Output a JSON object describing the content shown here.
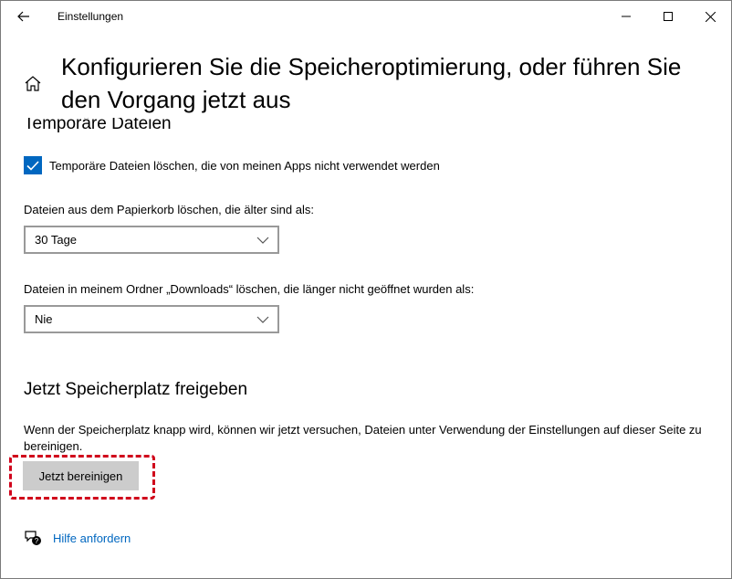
{
  "window": {
    "title": "Einstellungen"
  },
  "header": {
    "heading": "Konfigurieren Sie die Speicheroptimierung, oder führen Sie den Vorgang jetzt aus"
  },
  "temp_files": {
    "section_title": "Temporäre Dateien",
    "checkbox_label": "Temporäre Dateien löschen, die von meinen Apps nicht verwendet werden",
    "checkbox_checked": true,
    "recycle_label": "Dateien aus dem Papierkorb löschen, die älter sind als:",
    "recycle_value": "30 Tage",
    "downloads_label": "Dateien in meinem Ordner „Downloads“ löschen, die länger nicht geöffnet wurden als:",
    "downloads_value": "Nie"
  },
  "free_now": {
    "section_title": "Jetzt Speicherplatz freigeben",
    "description": "Wenn der Speicherplatz knapp wird, können wir jetzt versuchen, Dateien unter Verwendung der Einstellungen auf dieser Seite zu bereinigen.",
    "button_label": "Jetzt bereinigen"
  },
  "help": {
    "link_label": "Hilfe anfordern"
  },
  "colors": {
    "accent": "#0067c0",
    "highlight": "#d0021b",
    "button_bg": "#cccccc"
  },
  "icons": {
    "back": "back-arrow-icon",
    "home": "home-icon",
    "minimize": "minimize-icon",
    "maximize": "maximize-icon",
    "close": "close-icon",
    "checkbox": "checkmark-icon",
    "dropdown": "chevron-down-icon",
    "help": "help-chat-icon"
  }
}
